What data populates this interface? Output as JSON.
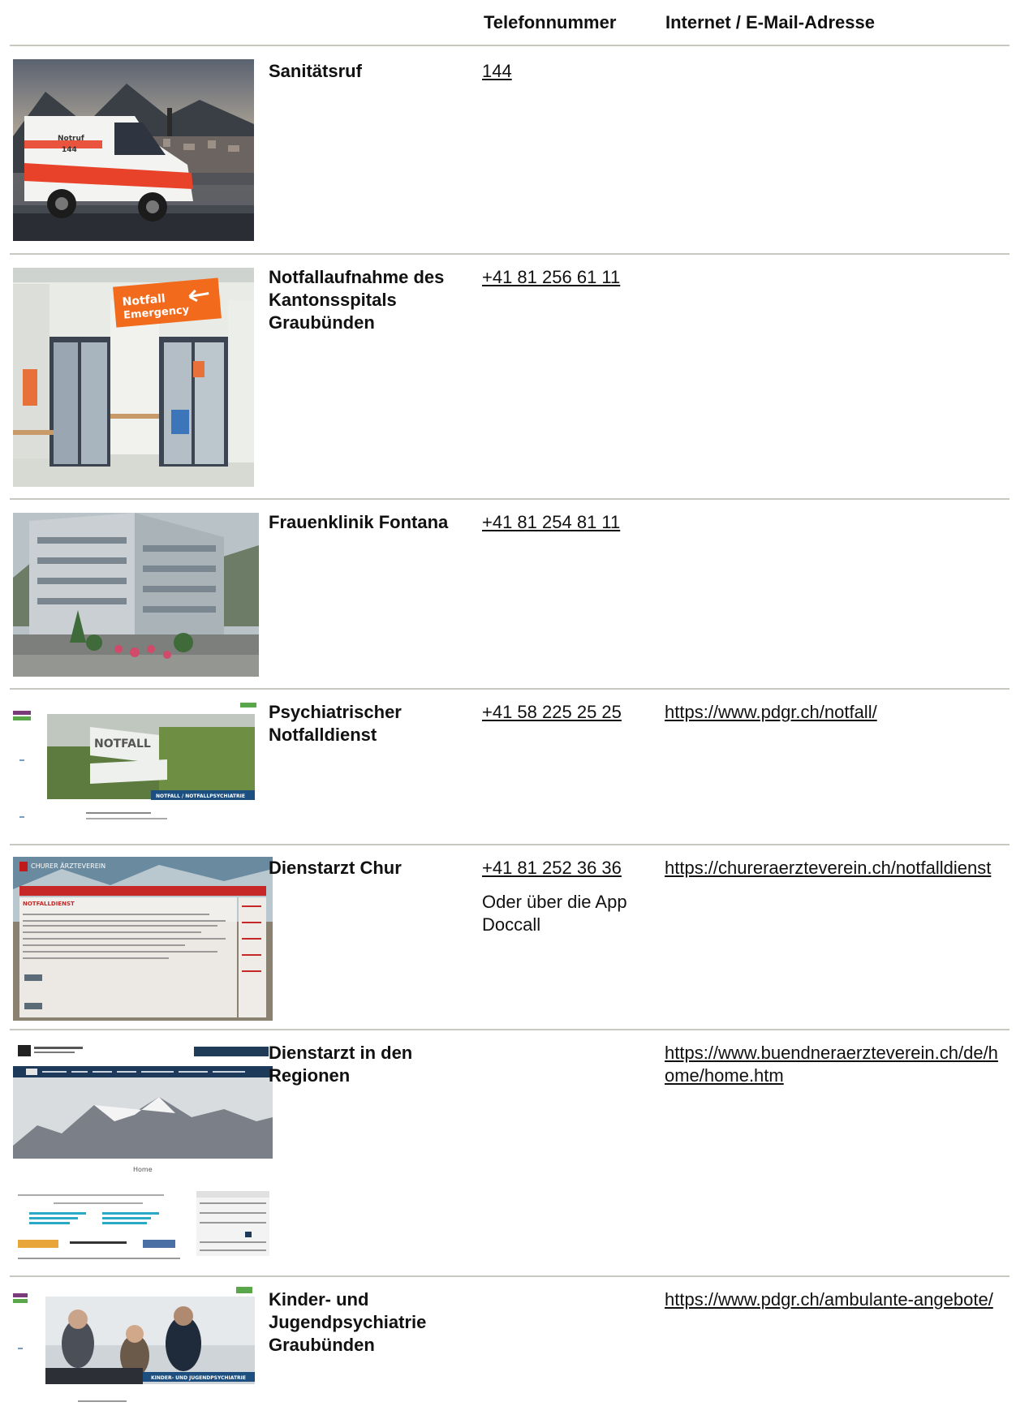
{
  "header": {
    "phone_col": "Telefonnummer",
    "web_col": "Internet / E-Mail-Adresse"
  },
  "rows": [
    {
      "name": "Sanitätsruf",
      "phone": "144",
      "web": ""
    },
    {
      "name": "Notfallaufnahme des Kantonsspitals Graubünden",
      "phone": "+41 81 256 61 11",
      "web": ""
    },
    {
      "name": "Frauenklinik Fontana",
      "phone": "+41 81 254 81 11",
      "web": ""
    },
    {
      "name": "Psychiatrischer Notfalldienst",
      "phone": "+41 58 225 25 25",
      "web": "https://www.pdgr.ch/notfall/"
    },
    {
      "name": "Dienstarzt Chur",
      "phone": "+41 81 252 36 36",
      "note": "Oder über die App Doccall",
      "web": "https://chureraerzteverein.ch/notfalldienst"
    },
    {
      "name": "Dienstarzt in den Regionen",
      "phone": "",
      "web": "https://www.buendneraerzteverein.ch/de/home/home.htm"
    },
    {
      "name": "Kinder- und Jugendpsychiatrie Graubünden",
      "phone": "",
      "web": "https://www.pdgr.ch/ambulante-angebote/"
    }
  ],
  "image_text": {
    "ambulance_line1": "Notruf",
    "ambulance_line2": "144",
    "sign_line1": "Notfall",
    "sign_line2": "Emergency",
    "notfall_sign": "NOTFALL",
    "notfall_banner": "NOTFALL / NOTFALLPSYCHIATRIE",
    "churer_logo": "CHURER ÄRZTEVEREIN",
    "churer_heading": "NOTFALLDIENST",
    "regions_home": "Home",
    "kjp_banner": "KINDER- UND JUGENDPSYCHIATRIE"
  }
}
